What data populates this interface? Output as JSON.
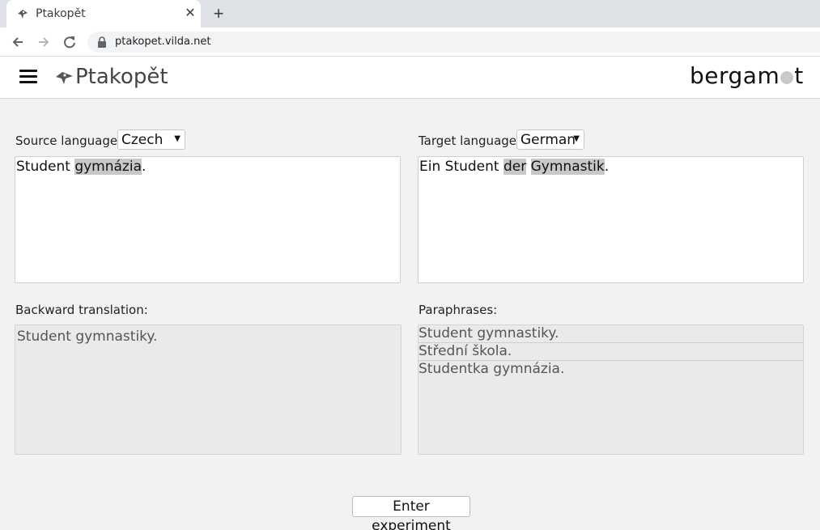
{
  "browser": {
    "tab_title": "Ptakopět",
    "tab_close": "✕",
    "new_tab": "+",
    "url": "ptakopet.vilda.net"
  },
  "header": {
    "brand_name": "Ptakopět",
    "partner_logo_before": "bergam",
    "partner_logo_after": "t"
  },
  "source": {
    "label": "Source language:",
    "selected_language": "Czech",
    "text_parts": [
      {
        "text": "Student ",
        "highlighted": false
      },
      {
        "text": "gymnázia",
        "highlighted": true
      },
      {
        "text": ".",
        "highlighted": false
      }
    ]
  },
  "target": {
    "label": "Target language:",
    "selected_language": "German",
    "text_parts": [
      {
        "text": "Ein Student ",
        "highlighted": false
      },
      {
        "text": "der",
        "highlighted": true
      },
      {
        "text": " ",
        "highlighted": false
      },
      {
        "text": "Gymnastik",
        "highlighted": true
      },
      {
        "text": ".",
        "highlighted": false
      }
    ]
  },
  "backward": {
    "label": "Backward translation:",
    "text": "Student gymnastiky."
  },
  "paraphrases": {
    "label": "Paraphrases:",
    "items": [
      "Student gymnastiky.",
      "Střední škola.",
      "Studentka gymnázia."
    ]
  },
  "actions": {
    "enter_experiment": "Enter experiment"
  },
  "colors": {
    "highlight": "#c8c8c8",
    "panel_bg": "#eaeaea",
    "page_bg": "#f2f2f2"
  }
}
